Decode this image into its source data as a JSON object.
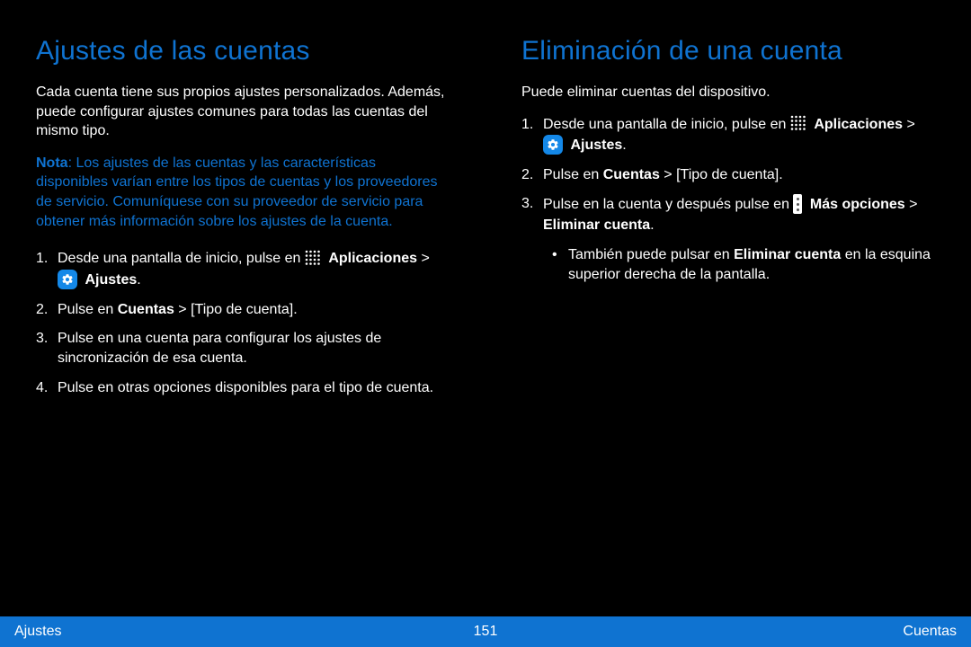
{
  "left": {
    "heading": "Ajustes de las cuentas",
    "intro": "Cada cuenta tiene sus propios ajustes personalizados. Además, puede configurar ajustes comunes para todas las cuentas del mismo tipo.",
    "note_label": "Nota",
    "note_body": ": Los ajustes de las cuentas y las características disponibles varían entre los tipos de cuentas y los proveedores de servicio. Comuníquese con su proveedor de servicio para obtener más información sobre los ajustes de la cuenta.",
    "steps": [
      {
        "num": "1.",
        "pre": "Desde una pantalla de inicio, pulse en ",
        "apps_label": "Aplicaciones",
        "mid": " > ",
        "settings_label": "Ajustes",
        "post": "."
      },
      {
        "num": "2.",
        "body_pre": "Pulse en ",
        "bold": "Cuentas",
        "body_post": " > [Tipo de cuenta]."
      },
      {
        "num": "3.",
        "body": "Pulse en una cuenta para configurar los ajustes de sincronización de esa cuenta."
      },
      {
        "num": "4.",
        "body": "Pulse en otras opciones disponibles para el tipo de cuenta."
      }
    ]
  },
  "right": {
    "heading": "Eliminación de una cuenta",
    "intro": "Puede eliminar cuentas del dispositivo.",
    "steps": [
      {
        "num": "1.",
        "pre": "Desde una pantalla de inicio, pulse en ",
        "apps_label": "Aplicaciones",
        "mid": " > ",
        "settings_label": "Ajustes",
        "post": "."
      },
      {
        "num": "2.",
        "body_pre": "Pulse en ",
        "bold": "Cuentas",
        "body_post": " > [Tipo de cuenta]."
      },
      {
        "num": "3.",
        "body": "Pulse en la cuenta y después pulse en ",
        "more_label": "Más opciones",
        "mid2": " > ",
        "bold2": "Eliminar cuenta",
        "post": "."
      }
    ],
    "bullet": {
      "dot": "•",
      "pre": "También puede pulsar en ",
      "bold": "Eliminar cuenta",
      "post": " en la esquina superior derecha de la pantalla."
    }
  },
  "footer": {
    "left": "Ajustes",
    "center": "151",
    "right": "Cuentas"
  }
}
